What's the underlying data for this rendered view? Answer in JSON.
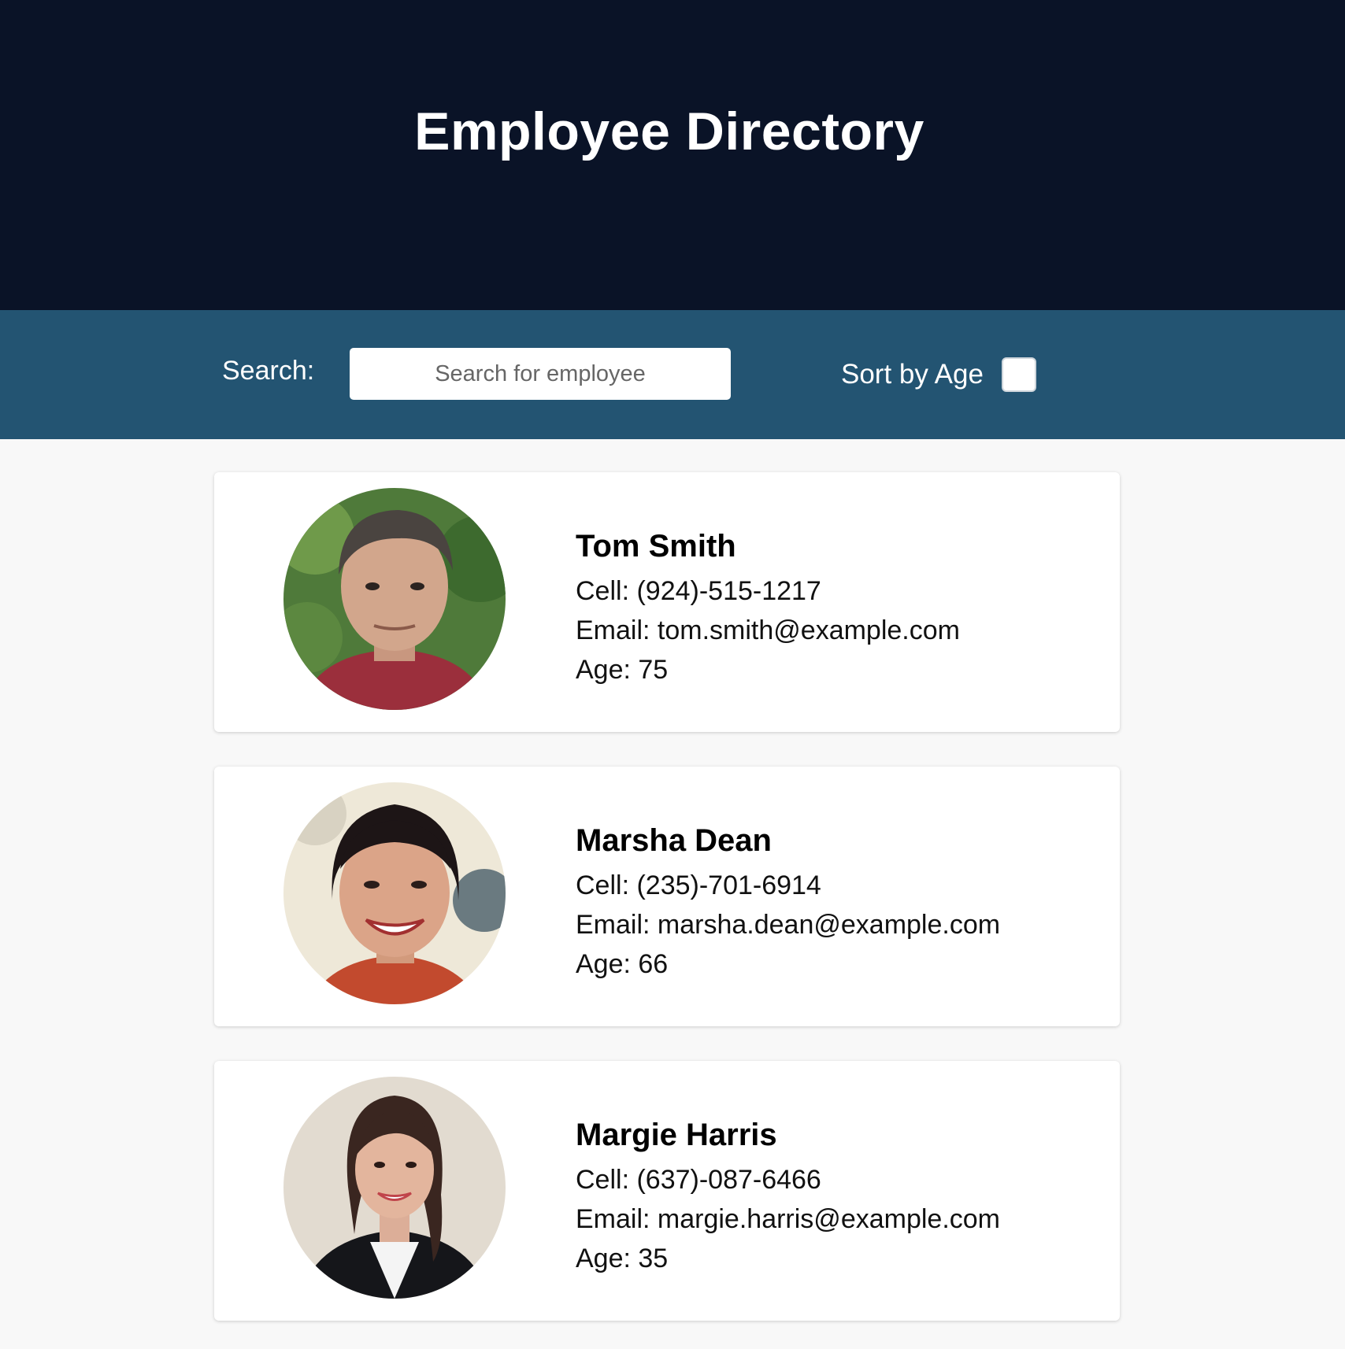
{
  "header": {
    "title": "Employee Directory"
  },
  "toolbar": {
    "search_label": "Search:",
    "search_placeholder": "Search for employee",
    "search_value": "",
    "sort_label": "Sort by Age",
    "sort_checked": false
  },
  "employees": [
    {
      "name": "Tom Smith",
      "cell": "Cell: (924)-515-1217",
      "email": "Email: tom.smith@example.com",
      "age": "Age: 75"
    },
    {
      "name": "Marsha Dean",
      "cell": "Cell: (235)-701-6914",
      "email": "Email: marsha.dean@example.com",
      "age": "Age: 66"
    },
    {
      "name": "Margie Harris",
      "cell": "Cell: (637)-087-6466",
      "email": "Email: margie.harris@example.com",
      "age": "Age: 35"
    }
  ],
  "colors": {
    "header_bg": "#0a1327",
    "toolbar_bg": "#235472",
    "page_bg": "#f8f8f8"
  }
}
